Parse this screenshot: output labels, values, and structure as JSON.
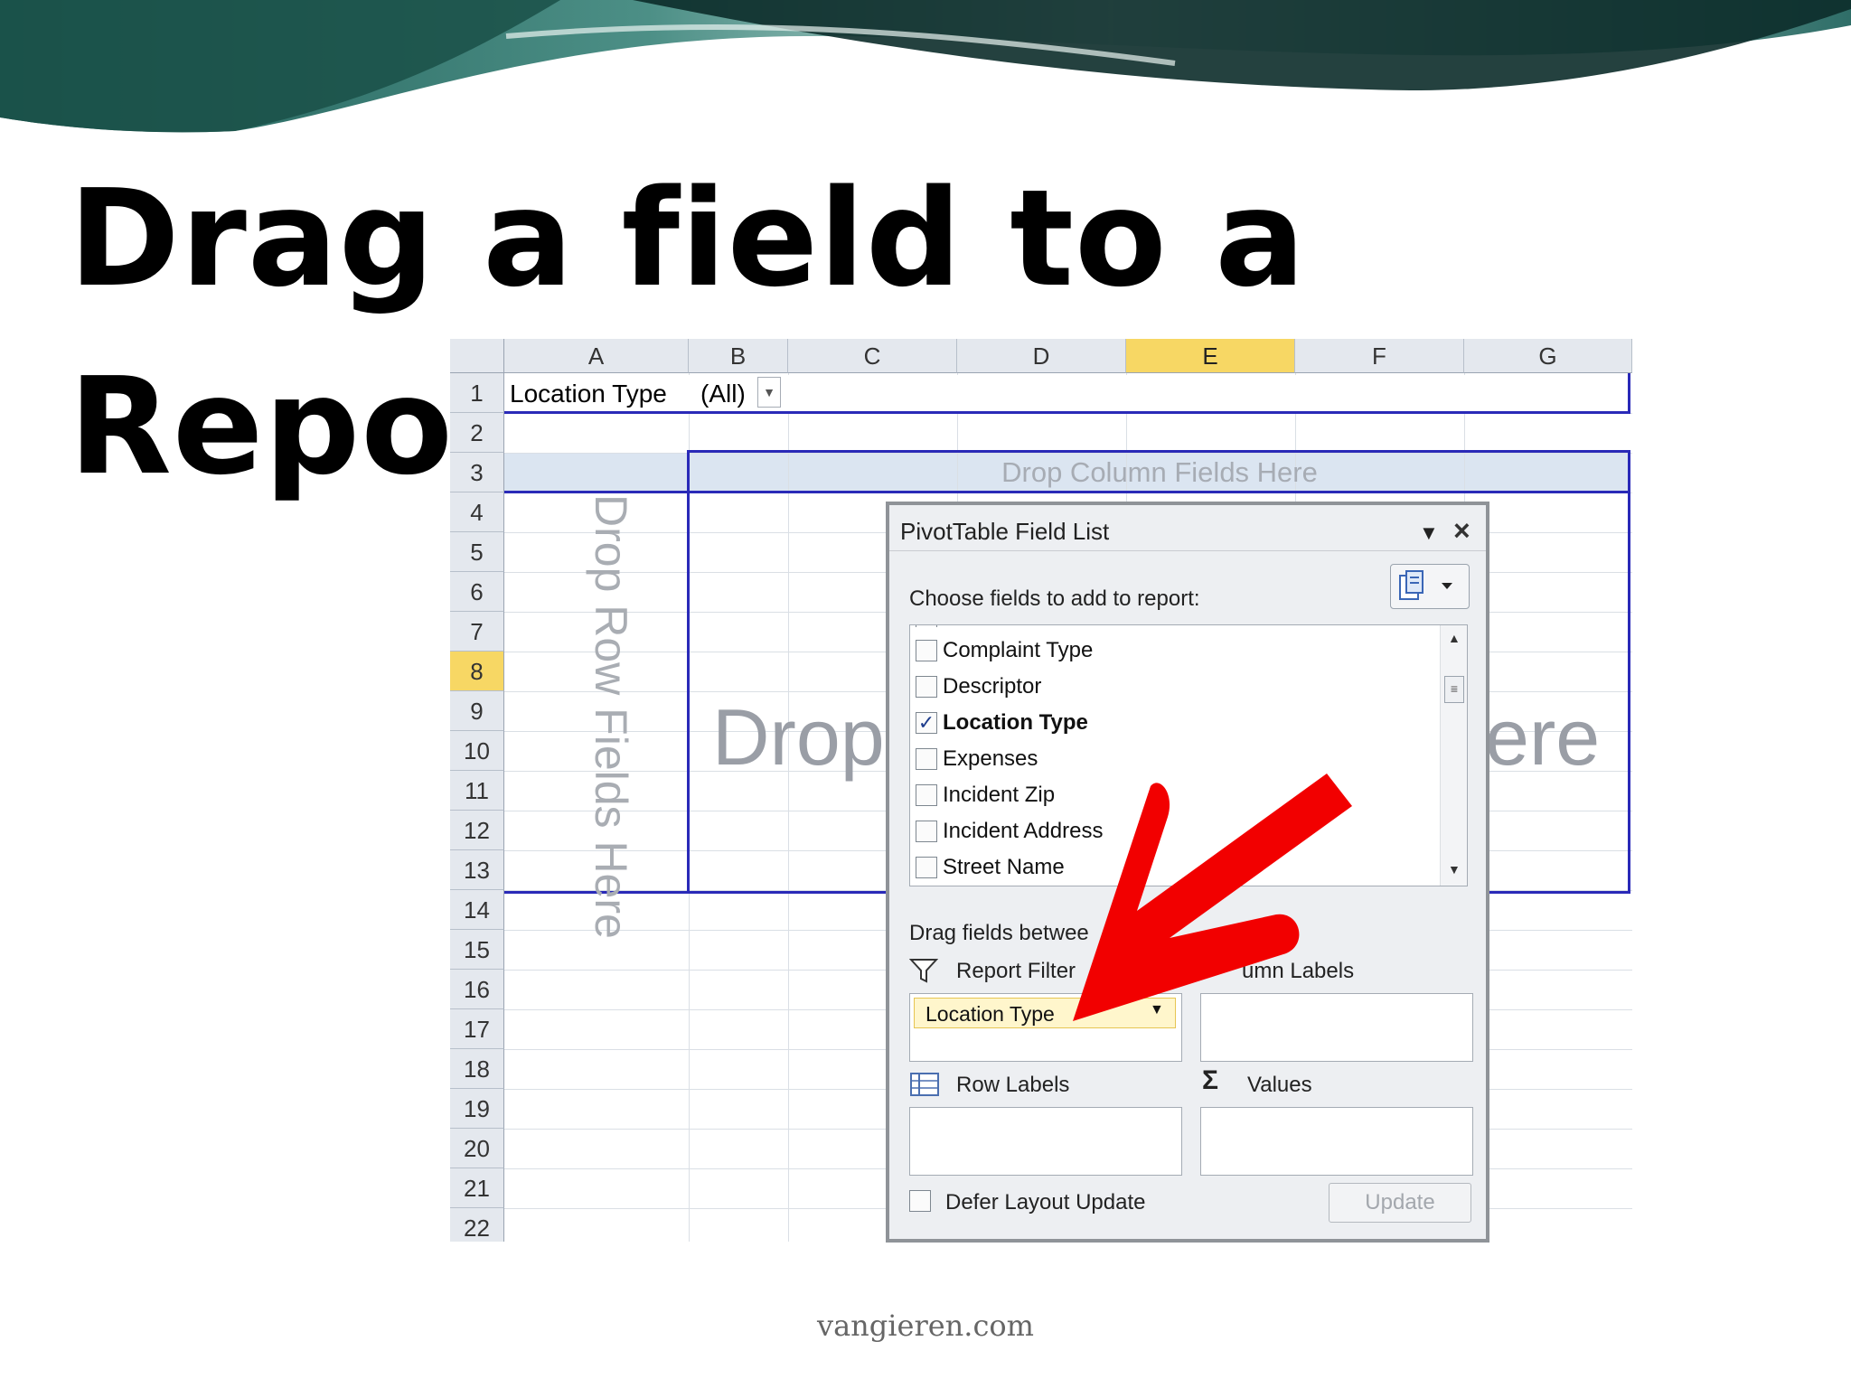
{
  "slide": {
    "title": "Drag a field to a Report Filter",
    "footer": "vangieren.com"
  },
  "sheet": {
    "columns": [
      "A",
      "B",
      "C",
      "D",
      "E",
      "F",
      "G"
    ],
    "selected_column": "E",
    "rows": [
      "1",
      "2",
      "3",
      "4",
      "5",
      "6",
      "7",
      "8",
      "9",
      "10",
      "11",
      "12",
      "13",
      "14",
      "15",
      "16",
      "17",
      "18",
      "19",
      "20",
      "21",
      "22"
    ],
    "selected_row": "8",
    "filter_label": "Location Type",
    "filter_value": "(All)",
    "drop_column": "Drop Column Fields Here",
    "drop_row": "Drop Row Fields Here",
    "drop_data_left": "Drop",
    "drop_data_right": "ere"
  },
  "pivot": {
    "title": "PivotTable Field List",
    "choose_label": "Choose fields to add to report:",
    "fields": [
      {
        "label": "Complaint Type",
        "checked": false
      },
      {
        "label": "Descriptor",
        "checked": false
      },
      {
        "label": "Location Type",
        "checked": true
      },
      {
        "label": "Expenses",
        "checked": false
      },
      {
        "label": "Incident Zip",
        "checked": false
      },
      {
        "label": "Incident Address",
        "checked": false
      },
      {
        "label": "Street Name",
        "checked": false
      }
    ],
    "drag_label": "Drag fields betwee",
    "report_filter": "Report Filter",
    "column_labels": "umn Labels",
    "row_labels": "Row Labels",
    "values": "Values",
    "report_filter_chip": "Location Type",
    "defer": "Defer Layout Update",
    "update": "Update"
  },
  "colors": {
    "pivot_border": "#2a2ab8",
    "arrow": "#f20000",
    "selected_header": "#f7d764",
    "chip": "#fff6cc"
  }
}
